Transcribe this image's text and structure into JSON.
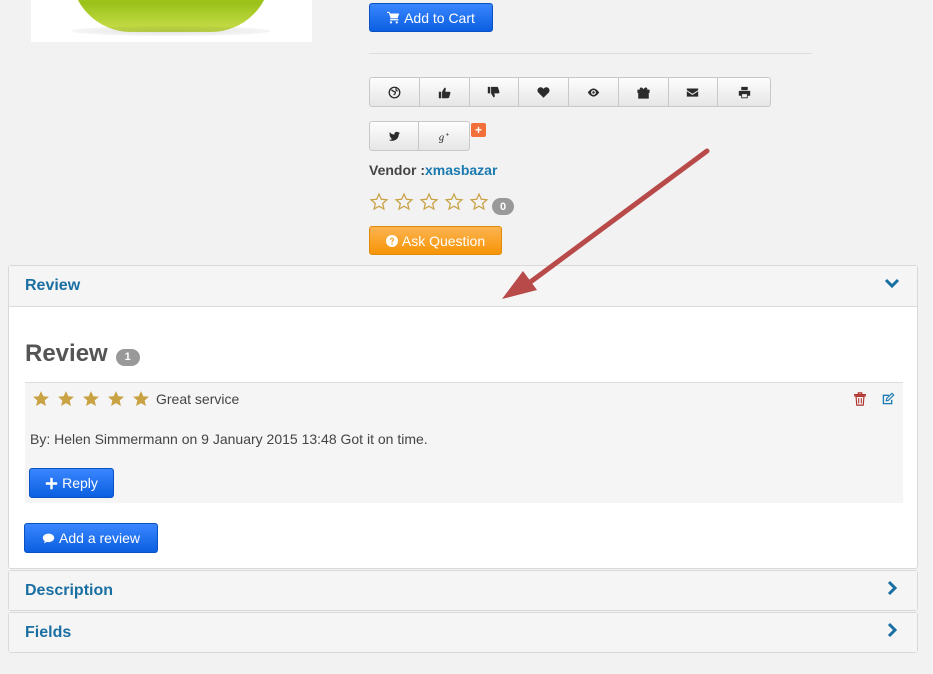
{
  "product": {
    "image_alt": "product image"
  },
  "cart": {
    "add_to_cart_label": "Add to Cart"
  },
  "share_buttons": [
    "globe-icon",
    "thumbs-up-icon",
    "thumbs-down-icon",
    "heart-icon",
    "eye-icon",
    "gift-icon",
    "envelope-icon",
    "print-icon"
  ],
  "social_buttons": [
    "twitter-icon",
    "google-plus-icon"
  ],
  "social_plus_badge": "+",
  "vendor": {
    "label": "Vendor :",
    "name": "xmasbazar"
  },
  "rating": {
    "stars": 0,
    "max_stars": 5,
    "count": "0"
  },
  "ask_question": {
    "label": "Ask Question"
  },
  "panels": {
    "review": {
      "title": "Review",
      "expanded": true
    },
    "description": {
      "title": "Description",
      "expanded": false
    },
    "fields": {
      "title": "Fields",
      "expanded": false
    }
  },
  "review_section": {
    "heading": "Review",
    "count": "1",
    "items": [
      {
        "stars": 5,
        "title": "Great service",
        "meta": "By: Helen Simmermann on 9 January 2015 13:48  Got it on time.",
        "reply_label": "Reply"
      }
    ],
    "add_review_label": "Add a review"
  },
  "colors": {
    "primary": "#0b5fe0",
    "warning": "#f89406",
    "link": "#1a6fa2",
    "star_filled": "#c9a244",
    "arrow": "#b84a4a",
    "delete": "#b0302a"
  }
}
